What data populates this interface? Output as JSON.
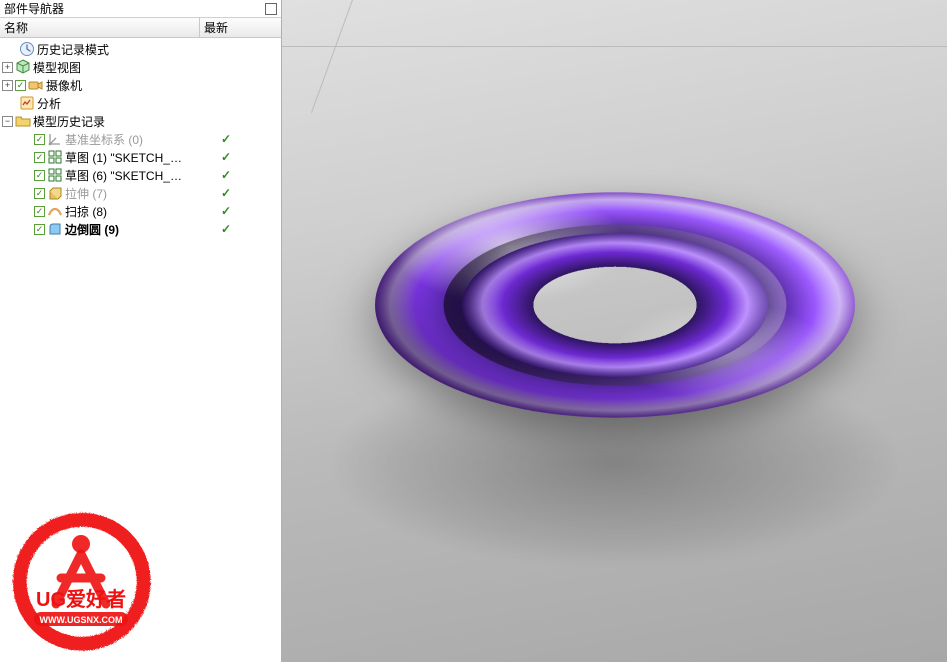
{
  "panel": {
    "title": "部件导航器",
    "columns": {
      "name": "名称",
      "latest": "最新"
    }
  },
  "tree": {
    "history_mode": "历史记录模式",
    "model_view": "模型视图",
    "camera": "摄像机",
    "analysis": "分析",
    "model_history": "模型历史记录",
    "items": {
      "datum": "基准坐标系 (0)",
      "sketch1": "草图 (1) \"SKETCH_…",
      "sketch6": "草图 (6) \"SKETCH_…",
      "extrude": "拉伸 (7)",
      "sweep": "扫掠 (8)",
      "edge_blend": "边倒圆 (9)"
    }
  },
  "logo": {
    "line1": "UG爱好者",
    "line2": "WWW.UGSNX.COM"
  }
}
